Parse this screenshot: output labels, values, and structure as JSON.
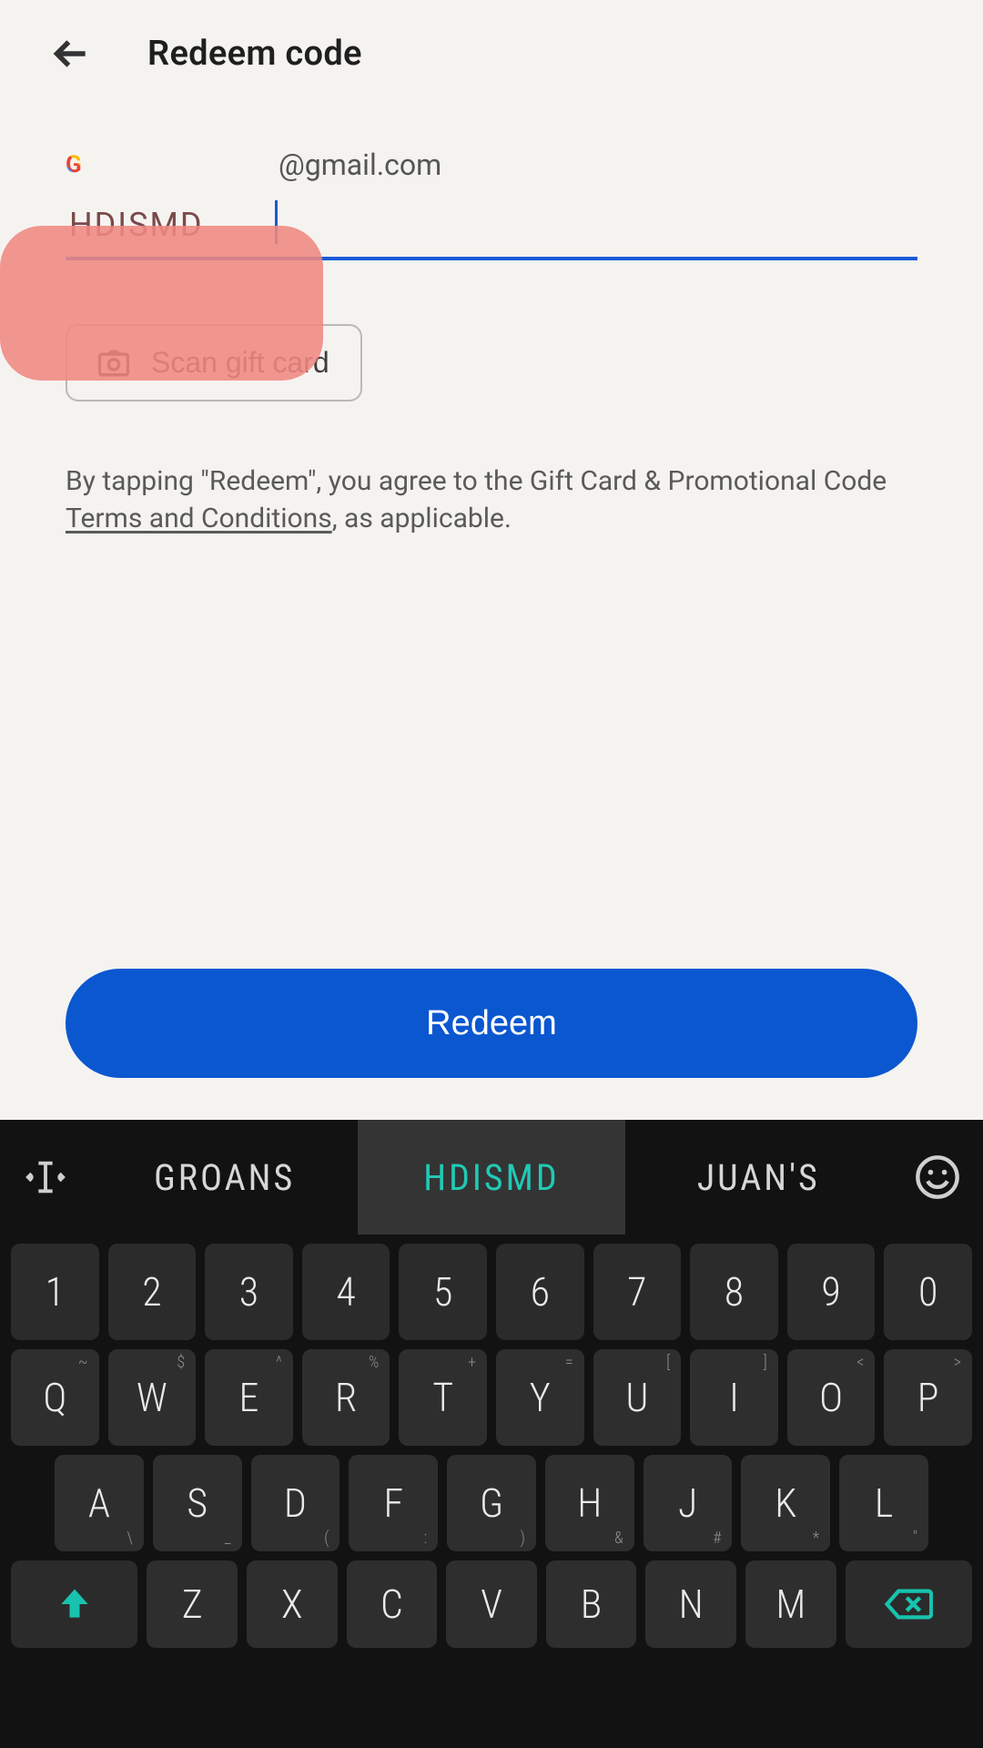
{
  "appbar": {
    "title": "Redeem code"
  },
  "account": {
    "email_suffix": "@gmail.com"
  },
  "code_input": {
    "value": "HDISMD"
  },
  "scan_button": {
    "label": "Scan gift card"
  },
  "legal": {
    "prefix": "By tapping \"Redeem\", you agree to the Gift Card & Promotional Code ",
    "terms_link": "Terms and Conditions",
    "suffix": ", as applicable."
  },
  "redeem_button": {
    "label": "Redeem"
  },
  "keyboard": {
    "suggestions": [
      "GROANS",
      "HDISMD",
      "JUAN'S"
    ],
    "active_suggestion_index": 1,
    "row_numbers": [
      "1",
      "2",
      "3",
      "4",
      "5",
      "6",
      "7",
      "8",
      "9",
      "0"
    ],
    "row_qwerty": [
      "Q",
      "W",
      "E",
      "R",
      "T",
      "Y",
      "U",
      "I",
      "O",
      "P"
    ],
    "row_qwerty_hints": [
      "~",
      "$",
      "^",
      "%",
      "+",
      "=",
      "[",
      "]",
      "<",
      ">"
    ],
    "row_home": [
      "A",
      "S",
      "D",
      "F",
      "G",
      "H",
      "J",
      "K",
      "L"
    ],
    "row_home_hints_bot": [
      "\\",
      "_",
      "(",
      ":",
      ")",
      "&",
      "#",
      "*",
      "\""
    ],
    "row_bottom": [
      "Z",
      "X",
      "C",
      "V",
      "B",
      "N",
      "M"
    ]
  }
}
